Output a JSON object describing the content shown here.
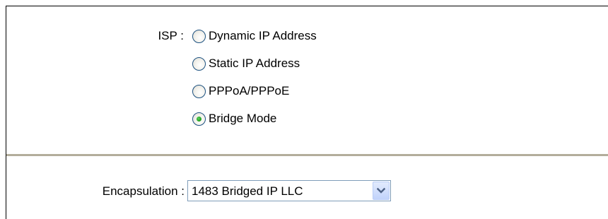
{
  "isp": {
    "label": "ISP :",
    "options": [
      {
        "label": "Dynamic IP Address",
        "selected": false
      },
      {
        "label": "Static IP Address",
        "selected": false
      },
      {
        "label": "PPPoA/PPPoE",
        "selected": false
      },
      {
        "label": "Bridge Mode",
        "selected": true
      }
    ]
  },
  "encapsulation": {
    "label": "Encapsulation :",
    "value": "1483 Bridged IP LLC",
    "icon": "chevron-down-icon"
  },
  "colors": {
    "divider": "#b3ad9b",
    "radio_border": "#1c5180",
    "radio_checked_dot": "#21a121",
    "select_border": "#7f9db9",
    "dropdown_button": "#c1d3fb"
  }
}
